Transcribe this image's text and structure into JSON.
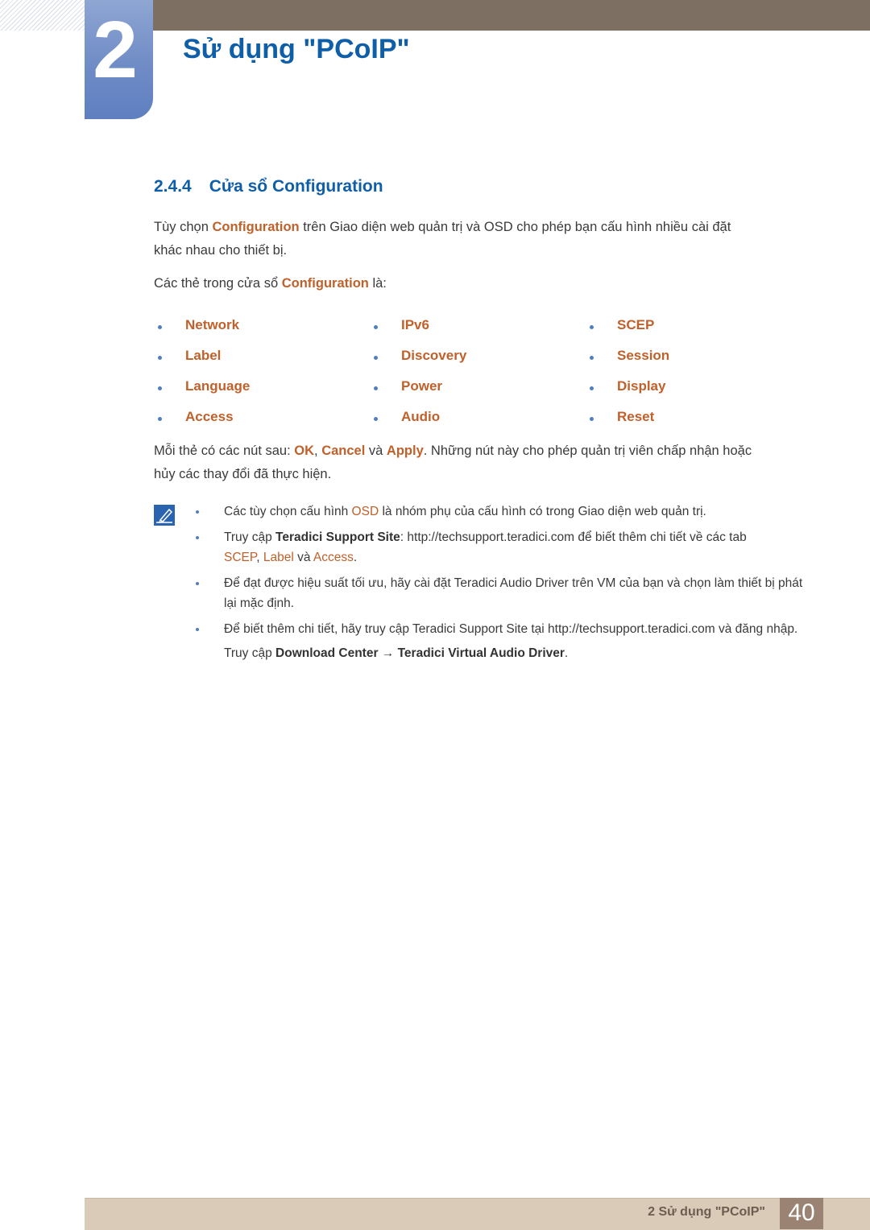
{
  "header": {
    "chapter_number": "2",
    "chapter_title": "Sử dụng \"PCoIP\""
  },
  "section": {
    "number": "2.4.4",
    "title": "Cửa sổ Configuration"
  },
  "intro": {
    "p1_before": "Tùy chọn ",
    "p1_highlight": "Configuration",
    "p1_after_line1": " trên Giao diện web quản trị và OSD cho phép bạn cấu hình nhiều cài đặt",
    "p1_line2": "khác nhau cho thiết bị.",
    "p2_before": "Các thẻ trong cửa sổ ",
    "p2_highlight": "Configuration",
    "p2_after": " là:"
  },
  "tabs": {
    "columns": [
      [
        "Network",
        "Label",
        "Language",
        "Access"
      ],
      [
        "IPv6",
        "Discovery",
        "Power",
        "Audio"
      ],
      [
        "SCEP",
        "Session",
        "Display",
        "Reset"
      ]
    ]
  },
  "buttons_para": {
    "before": "Mỗi thẻ có các nút sau: ",
    "ok": "OK",
    "sep1": ", ",
    "cancel": "Cancel",
    "sep2": " và ",
    "apply": "Apply",
    "after_line1": ". Những nút này cho phép quản trị viên chấp nhận hoặc",
    "line2": "hủy các thay đổi đã thực hiện."
  },
  "notes": {
    "icon": "note-pencil-icon",
    "n1_before": "Các tùy chọn cấu hình ",
    "n1_highlight": "OSD",
    "n1_after": " là nhóm phụ của cấu hình có trong Giao diện web quản trị.",
    "n2_before": "Truy cập ",
    "n2_bold": "Teradici Support Site",
    "n2_after": ": http://techsupport.teradici.com để biết thêm chi tiết về các tab",
    "n2_scep": "SCEP",
    "n2_sep1": ", ",
    "n2_label": "Label",
    "n2_sep2": " và ",
    "n2_access": "Access",
    "n2_end": ".",
    "n3": "Để đạt được hiệu suất tối ưu, hãy cài đặt Teradici Audio Driver trên VM của bạn và chọn làm thiết bị phát lại mặc định.",
    "n4": "Để biết thêm chi tiết, hãy truy cập Teradici Support Site tại http://techsupport.teradici.com và đăng nhập.",
    "n4_sub_before": "Truy cập ",
    "n4_sub_bold1": "Download Center",
    "n4_sub_arrow": " → ",
    "n4_sub_bold2": "Teradici Virtual Audio Driver",
    "n4_sub_end": "."
  },
  "footer": {
    "chapter_label": "2 Sử dụng \"PCoIP\"",
    "page_number": "40"
  },
  "colors": {
    "accent_blue": "#0f5ea8",
    "highlight_orange": "#c0602a",
    "header_bar": "#7d6f62",
    "footer_bar": "#dacbb8"
  }
}
